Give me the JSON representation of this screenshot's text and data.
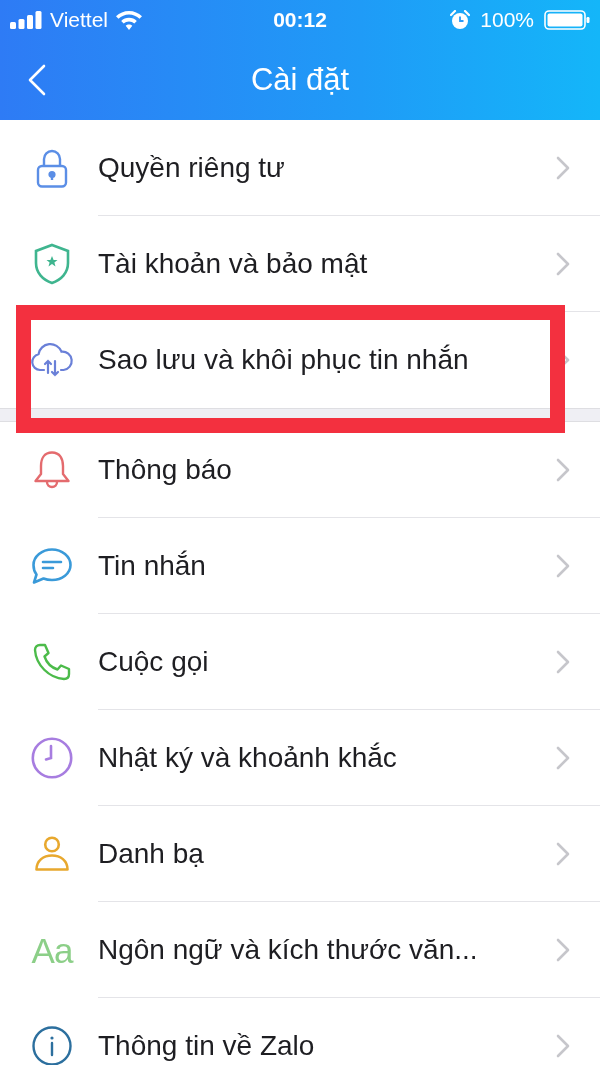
{
  "status_bar": {
    "carrier": "Viettel",
    "time": "00:12",
    "battery": "100%"
  },
  "header": {
    "title": "Cài đặt"
  },
  "sections": [
    {
      "items": [
        {
          "label": "Quyền riêng tư",
          "color": "#5b8ee6",
          "highlighted": false
        },
        {
          "label": "Tài khoản và bảo mật",
          "color": "#3fb58f",
          "highlighted": false
        },
        {
          "label": "Sao lưu và khôi phục tin nhắn",
          "color": "#6a80d8",
          "highlighted": true
        }
      ]
    },
    {
      "items": [
        {
          "label": "Thông báo",
          "color": "#e46b6e",
          "highlighted": false
        },
        {
          "label": "Tin nhắn",
          "color": "#3a9ad9",
          "highlighted": false
        },
        {
          "label": "Cuộc gọi",
          "color": "#4cbb4a",
          "highlighted": false
        },
        {
          "label": "Nhật ký và khoảnh khắc",
          "color": "#a77de0",
          "highlighted": false
        },
        {
          "label": "Danh bạ",
          "color": "#e8a82e",
          "highlighted": false
        },
        {
          "label": "Ngôn ngữ và kích thước văn...",
          "color": "#8ccf88",
          "icon_text": "Aa",
          "highlighted": false
        },
        {
          "label": "Thông tin về Zalo",
          "color": "#2c6f9e",
          "highlighted": false
        }
      ]
    }
  ]
}
